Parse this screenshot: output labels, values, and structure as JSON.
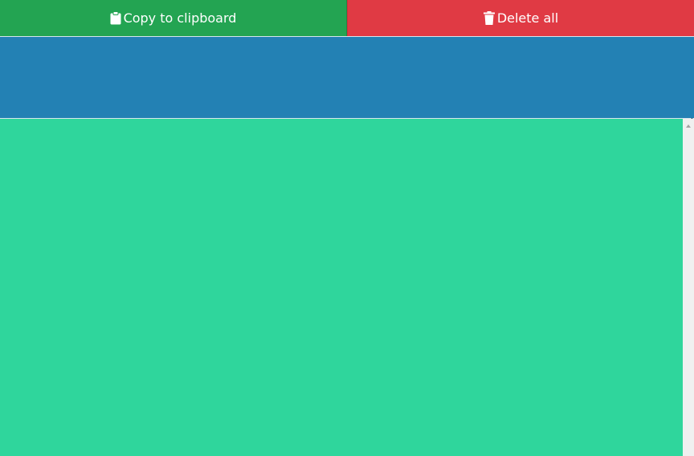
{
  "toolbar": {
    "copy_label": "Copy to clipboard",
    "copy_icon": "clipboard-icon",
    "delete_label": "Delete all",
    "delete_icon": "trash-icon"
  },
  "colors": {
    "copy_button": "#23a452",
    "delete_button": "#e03a44",
    "input_area": "#2381b4",
    "output_area": "#2fd69c",
    "scrollbar_track": "#f0f0f0"
  },
  "input": {
    "value": ""
  }
}
